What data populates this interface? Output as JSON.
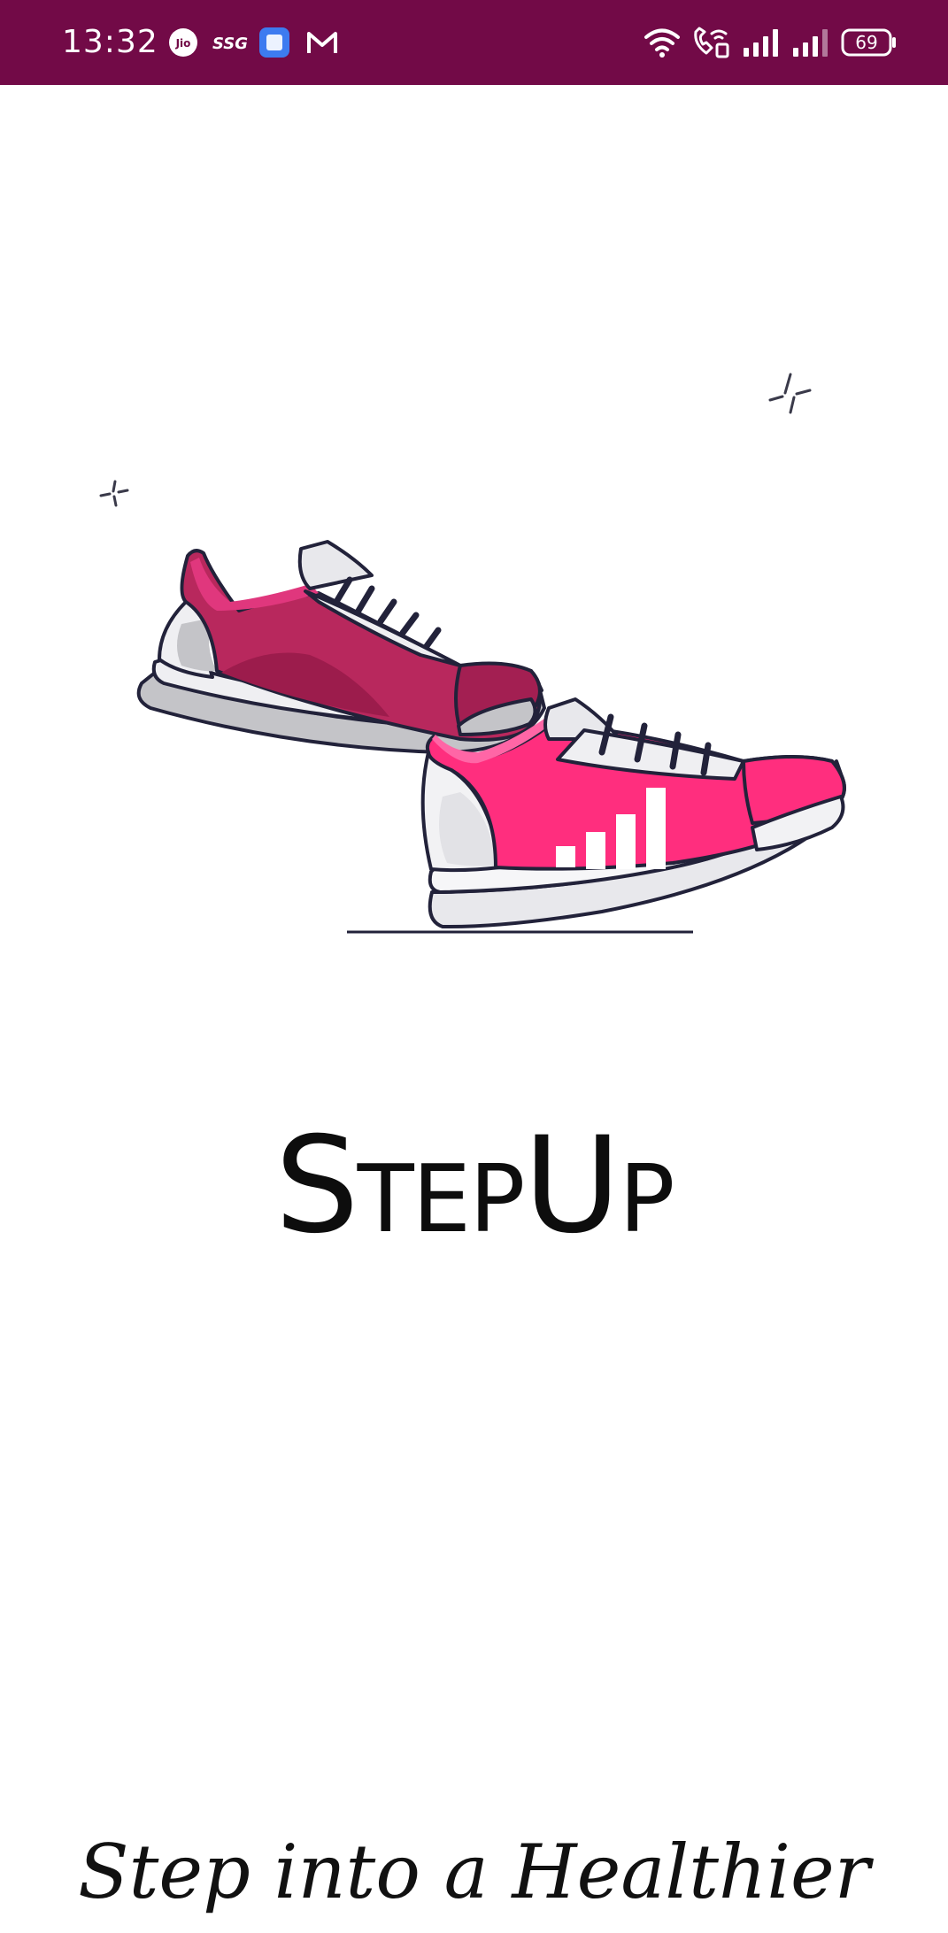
{
  "status_bar": {
    "time": "13:32",
    "battery_level": "69",
    "background": "#720a47",
    "notification_icons": [
      "jio-icon",
      "ssg-icon",
      "app-icon",
      "gmail-icon"
    ],
    "system_icons": [
      "wifi-icon",
      "wifi-calling-icon",
      "signal-icon",
      "signal-icon",
      "battery-icon"
    ]
  },
  "app": {
    "title": "StepUp",
    "tagline": "Step into a Healthier you"
  },
  "hero": {
    "illustration": "sneakers-illustration",
    "colors": {
      "shoe_back": "#b8285d",
      "shoe_front": "#ff2e7e",
      "sole": "#e8e8e8",
      "outline": "#22223a"
    }
  }
}
